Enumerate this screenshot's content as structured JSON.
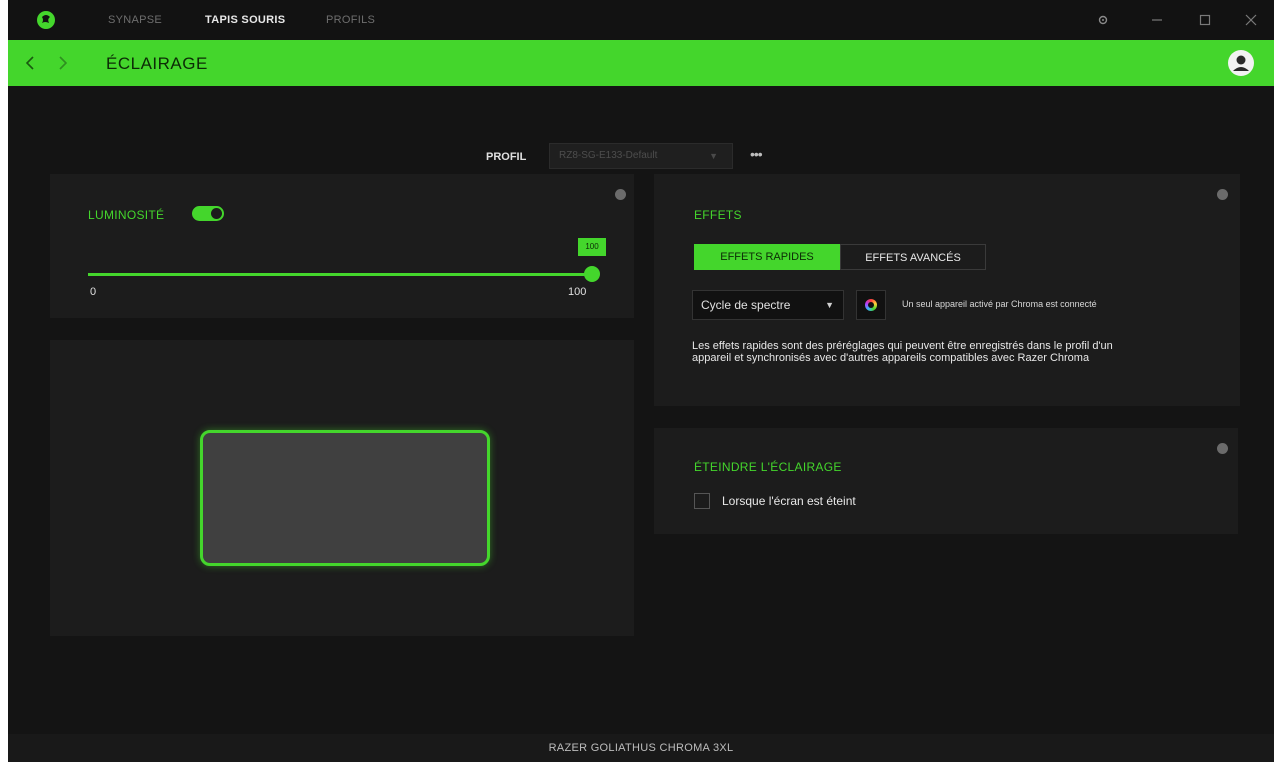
{
  "colors": {
    "accent": "#44d62c",
    "background": "#141414",
    "panel": "#1c1c1c"
  },
  "titlebar": {
    "logo_icon": "razer-snake-icon",
    "tabs": [
      {
        "label": "SYNAPSE",
        "active": false
      },
      {
        "label": "TAPIS SOURIS",
        "active": true
      },
      {
        "label": "PROFILS",
        "active": false
      }
    ],
    "window_icons": [
      "settings-icon",
      "minimize-icon",
      "maximize-icon",
      "close-icon"
    ]
  },
  "header": {
    "title": "ÉCLAIRAGE",
    "back_icon": "chevron-left-icon",
    "forward_icon": "chevron-right-icon",
    "avatar_icon": "user-avatar-icon"
  },
  "profile": {
    "label": "PROFIL",
    "selected": "RZ8-SG-E133-Default",
    "more_label": "•••"
  },
  "brightness": {
    "label": "LUMINOSITÉ",
    "enabled": true,
    "value": 100,
    "value_label": "100",
    "min_label": "0",
    "max_label": "100"
  },
  "effects": {
    "title": "EFFETS",
    "tabs": [
      {
        "label": "EFFETS RAPIDES",
        "active": true
      },
      {
        "label": "EFFETS AVANCÉS",
        "active": false
      }
    ],
    "selected_effect": "Cycle de spectre",
    "chroma_note": "Un seul appareil activé par Chroma est connecté",
    "description": "Les effets rapides sont des préréglages qui peuvent être enregistrés dans le profil d'un appareil et synchronisés avec d'autres appareils compatibles avec Razer Chroma"
  },
  "lighting_off": {
    "title": "ÉTEINDRE L'ÉCLAIRAGE",
    "checkbox_label": "Lorsque l'écran est éteint",
    "checked": false
  },
  "footer": {
    "device_name": "RAZER GOLIATHUS CHROMA 3XL"
  }
}
